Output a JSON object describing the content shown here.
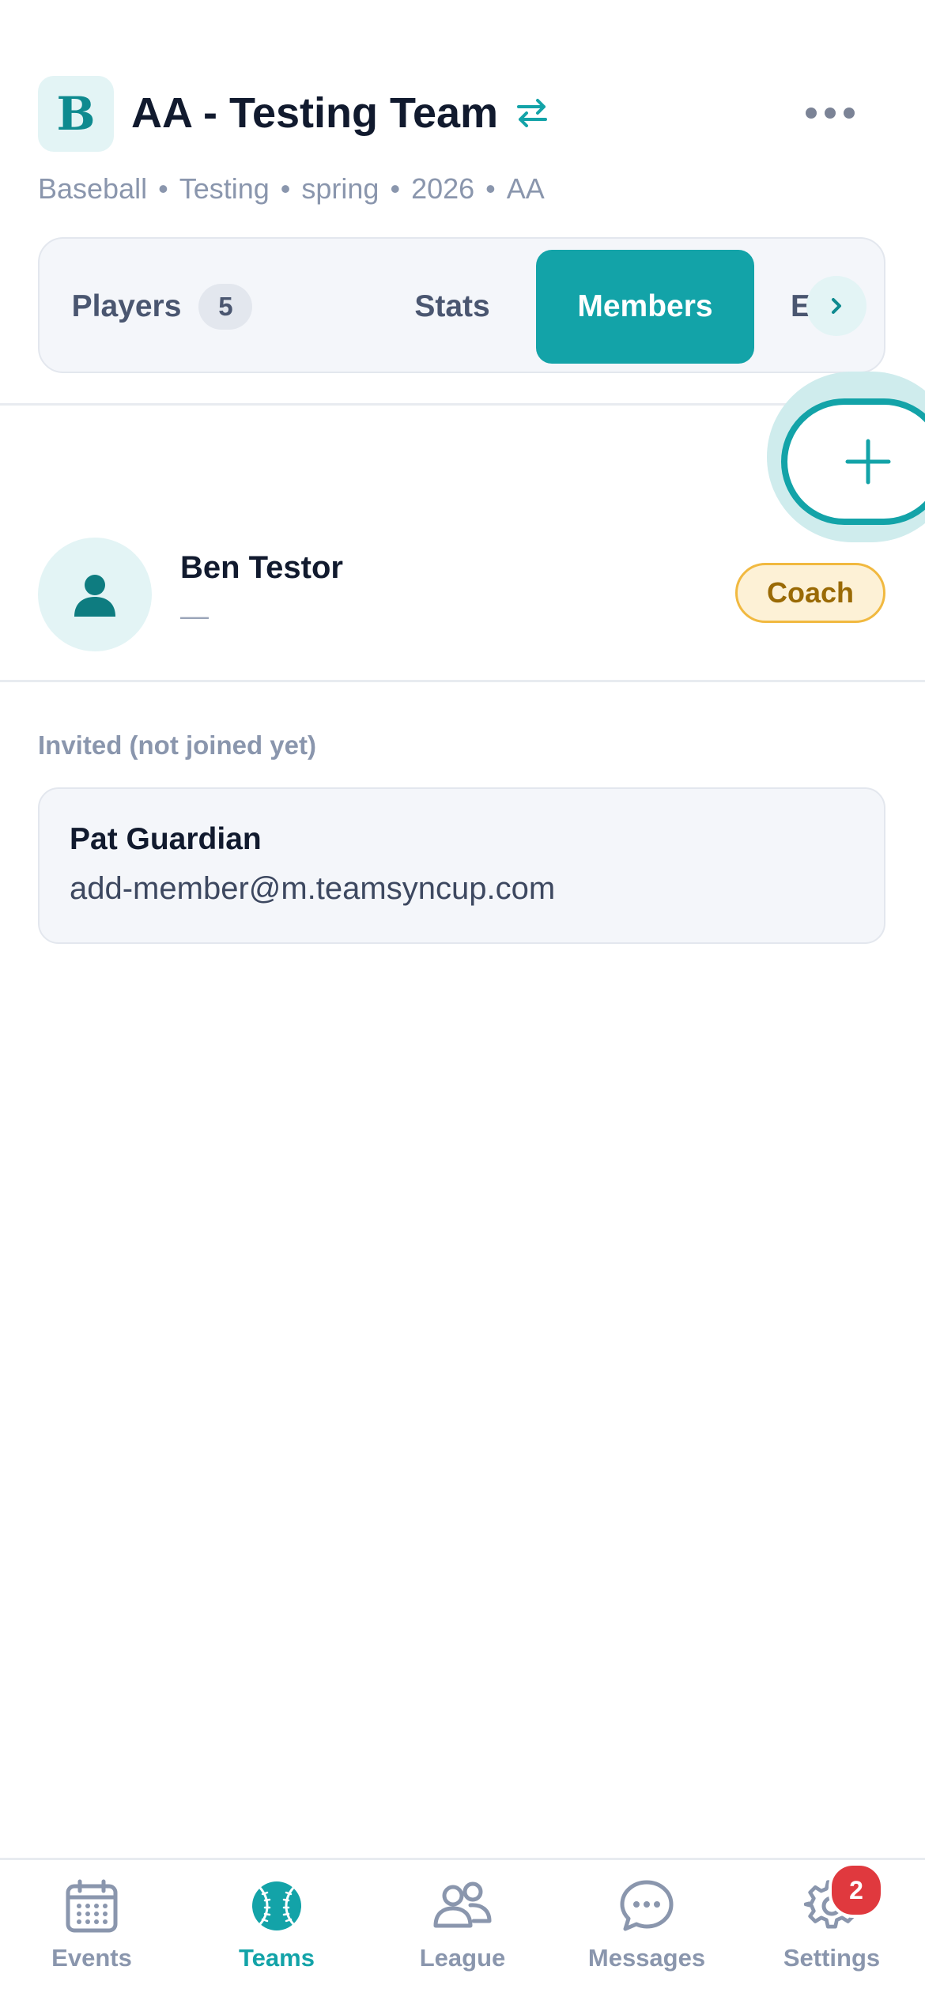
{
  "header": {
    "badge_letter": "B",
    "title": "AA - Testing Team",
    "subtitle_parts": [
      "Baseball",
      "Testing",
      "spring",
      "2026",
      "AA"
    ],
    "separator": "•"
  },
  "tabs": {
    "players_label": "Players",
    "players_count": "5",
    "stats_label": "Stats",
    "members_label": "Members",
    "extra_label": "Edu",
    "active": "Members"
  },
  "members": [
    {
      "name": "Ben Testor",
      "subtitle": "—",
      "role": "Coach"
    }
  ],
  "invited": {
    "heading": "Invited (not joined yet)",
    "items": [
      {
        "name": "Pat Guardian",
        "email": "add-member@m.teamsyncup.com"
      }
    ]
  },
  "bottom_nav": {
    "items": [
      {
        "label": "Events",
        "icon": "calendar-icon"
      },
      {
        "label": "Teams",
        "icon": "baseball-icon"
      },
      {
        "label": "League",
        "icon": "people-icon"
      },
      {
        "label": "Messages",
        "icon": "chat-bubble-icon"
      },
      {
        "label": "Settings",
        "icon": "gear-icon"
      }
    ],
    "active": "Teams",
    "settings_badge": "2"
  },
  "colors": {
    "accent": "#13a3a8",
    "accent_light": "#e3f4f5",
    "coach_badge_bg": "#fdf1d6",
    "coach_badge_border": "#f1b940",
    "notification_red": "#e0393e"
  }
}
